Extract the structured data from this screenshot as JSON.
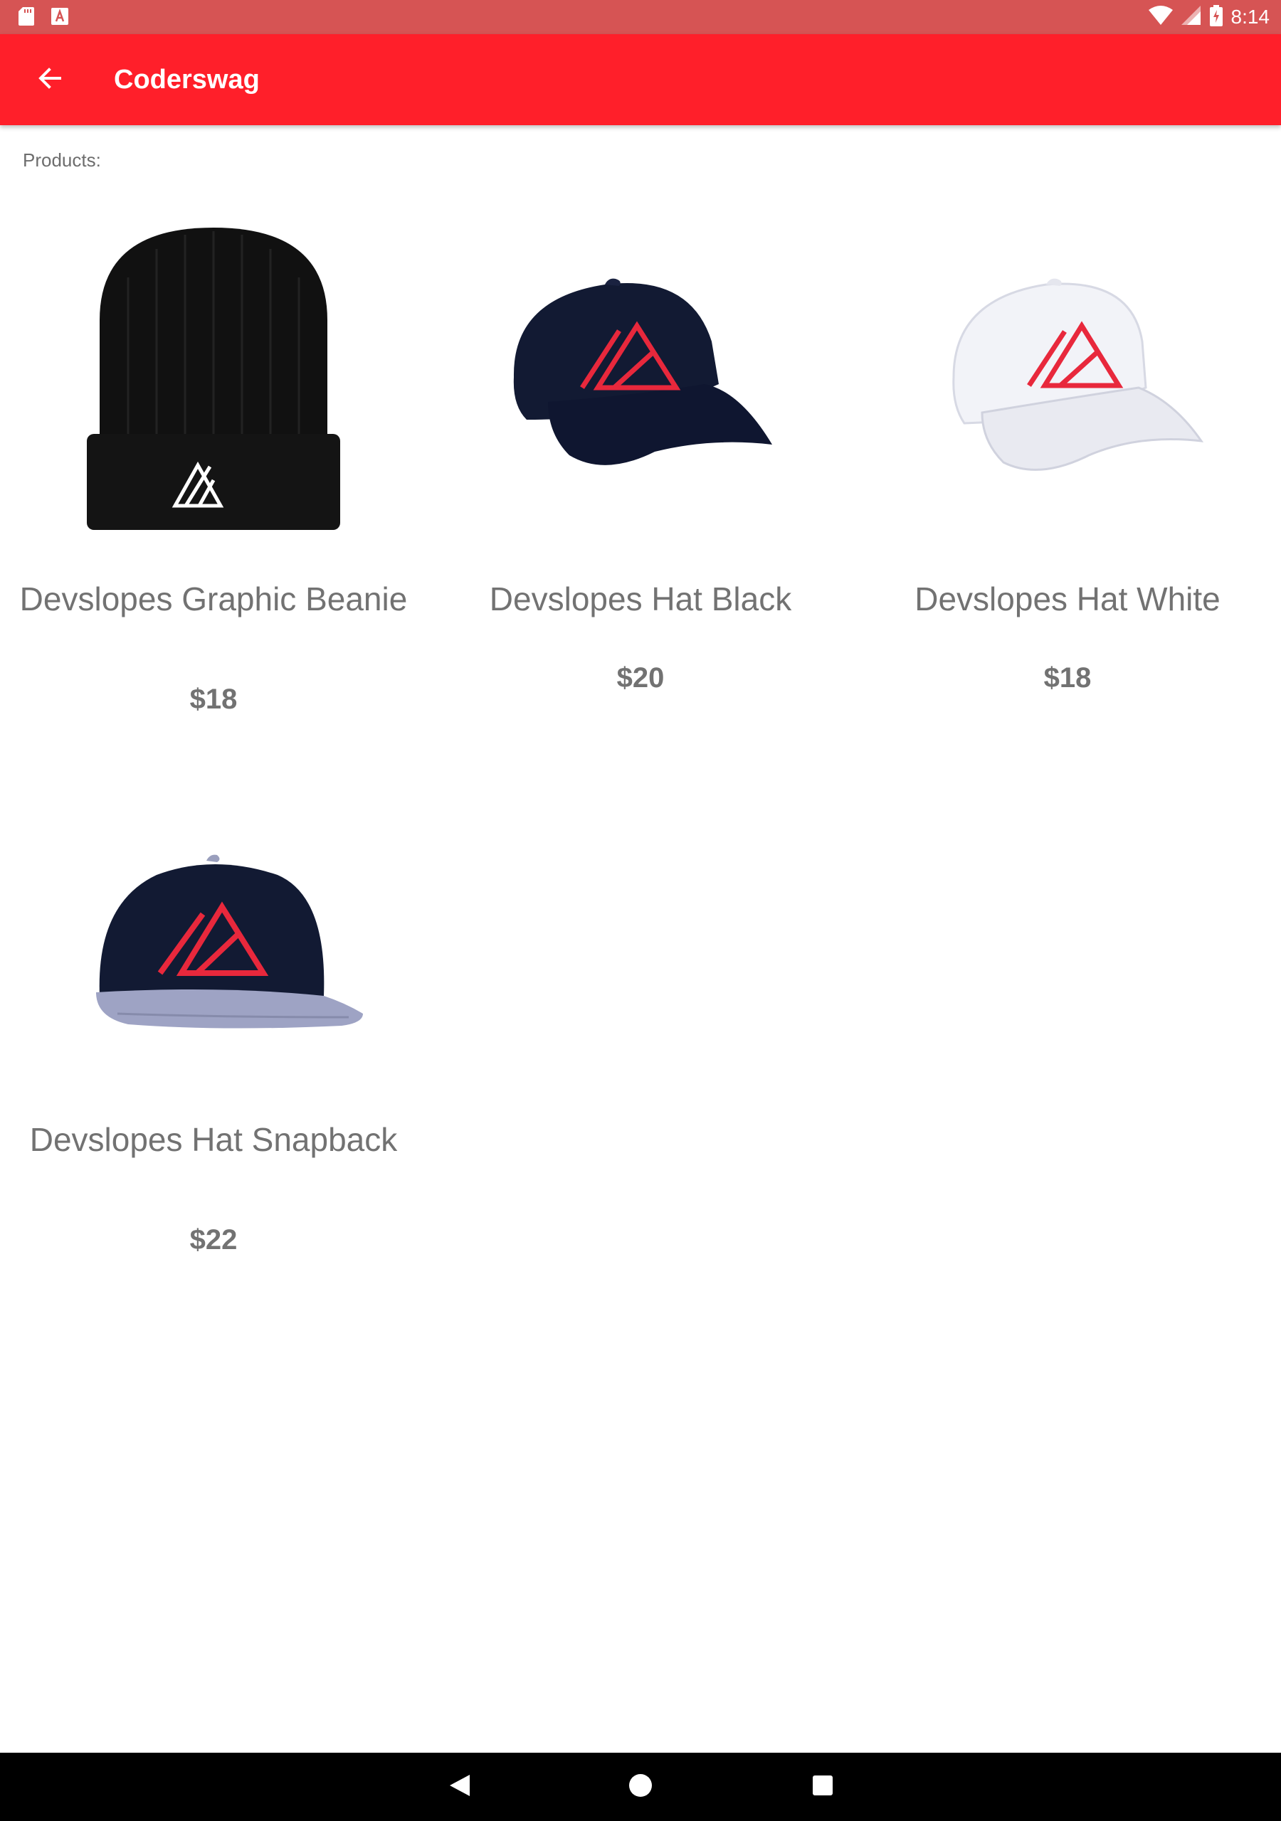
{
  "status_bar": {
    "time": "8:14",
    "icons": [
      "sd-card-icon",
      "a-icon",
      "wifi-icon",
      "signal-icon",
      "battery-charging-icon"
    ]
  },
  "app_bar": {
    "title": "Coderswag",
    "back_icon": "arrow-back-icon",
    "color": "#ff1f2a"
  },
  "section_label": "Products:",
  "products": [
    {
      "name": "Devslopes Graphic Beanie",
      "price": "$18",
      "image": "black-beanie"
    },
    {
      "name": "Devslopes Hat Black",
      "price": "$20",
      "image": "black-cap"
    },
    {
      "name": "Devslopes Hat White",
      "price": "$18",
      "image": "white-cap"
    },
    {
      "name": "Devslopes Hat Snapback",
      "price": "$22",
      "image": "snapback-cap"
    }
  ],
  "nav_bar": {
    "buttons": [
      "back-triangle-icon",
      "home-circle-icon",
      "recents-square-icon"
    ]
  },
  "colors": {
    "status_bar": "#d65454",
    "logo_red": "#e8283c",
    "text_gray": "#727272"
  }
}
